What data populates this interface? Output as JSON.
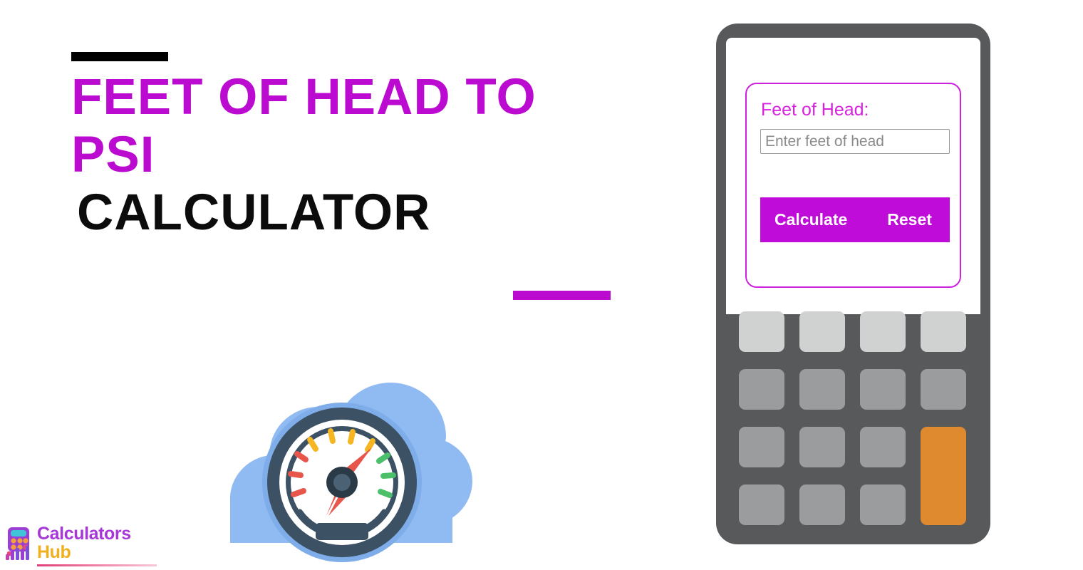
{
  "page": {
    "background": "#ffffff",
    "accent_magenta": "#bc0bd0",
    "accent_orange": "#e08a30",
    "device_body": "#58595b"
  },
  "hero": {
    "title_lines": [
      {
        "text": "FEET OF HEAD TO",
        "color": "magenta"
      },
      {
        "text": "PSI",
        "color": "magenta"
      },
      {
        "text": "CALCULATOR",
        "color": "dark"
      }
    ],
    "rule_top": "black-rule",
    "rule_bottom": "magenta-rule"
  },
  "illustration": {
    "name": "pressure-gauge-cloud-illustration",
    "cloud_color": "#90baf2",
    "cloud_shadow_color": "#7aa9e8",
    "bezel_color": "#3c5264",
    "face_color": "#ffffff",
    "needle_color": "#e8564b",
    "hub_color": "#2a3b47",
    "hub_inner_color": "#4a6273",
    "tick_colors": [
      "#e8564b",
      "#f5b622",
      "#4cbf6a"
    ],
    "display_color": "#3c5264"
  },
  "brand": {
    "name_line1": "Calculators",
    "name_line2": "Hub",
    "color_line1": "#a837d8",
    "color_line2": "#f0b020",
    "mark": "calculator-bars-logo"
  },
  "calculator": {
    "form": {
      "label": "Feet of Head:",
      "label_color": "#d822e0",
      "input_value": "",
      "input_placeholder": "Enter feet of head",
      "card_border_color": "#cc22dd"
    },
    "buttons": {
      "calculate_label": "Calculate",
      "reset_label": "Reset",
      "bar_color": "#c00cd8",
      "text_color": "#ffffff"
    },
    "keypad": {
      "rows": 4,
      "columns": 4,
      "keys": [
        {
          "id": "key-r1c1",
          "tone": "light"
        },
        {
          "id": "key-r1c2",
          "tone": "light"
        },
        {
          "id": "key-r1c3",
          "tone": "light"
        },
        {
          "id": "key-r1c4",
          "tone": "light"
        },
        {
          "id": "key-r2c1",
          "tone": "normal"
        },
        {
          "id": "key-r2c2",
          "tone": "normal"
        },
        {
          "id": "key-r2c3",
          "tone": "normal"
        },
        {
          "id": "key-r2c4",
          "tone": "normal"
        },
        {
          "id": "key-r3c1",
          "tone": "normal"
        },
        {
          "id": "key-r3c2",
          "tone": "normal"
        },
        {
          "id": "key-r3c3",
          "tone": "normal"
        },
        {
          "id": "key-equals",
          "tone": "accent"
        },
        {
          "id": "key-r4c1",
          "tone": "normal"
        },
        {
          "id": "key-r4c2",
          "tone": "normal"
        },
        {
          "id": "key-r4c3",
          "tone": "normal"
        }
      ],
      "light_color": "#d0d1d1",
      "normal_color": "#9b9c9e",
      "accent_color": "#e08a30"
    }
  }
}
